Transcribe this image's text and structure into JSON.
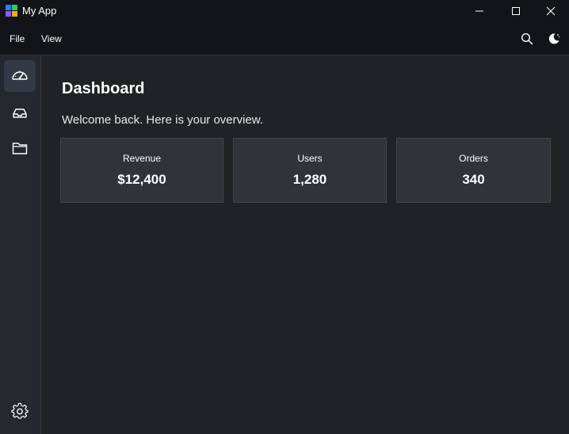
{
  "app": {
    "title": "My App",
    "logo_colors": [
      "#2e7df6",
      "#2ecc71",
      "#8f5cf6",
      "#f5a623"
    ]
  },
  "window_controls": {
    "minimize_icon": "minimize-icon",
    "maximize_icon": "maximize-icon",
    "close_icon": "close-icon"
  },
  "menu": {
    "items": [
      {
        "label": "File"
      },
      {
        "label": "View"
      }
    ],
    "right_icons": [
      "search-icon",
      "theme-moon-icon"
    ]
  },
  "sidebar": {
    "items": [
      {
        "icon": "dashboard-gauge-icon",
        "active": true
      },
      {
        "icon": "inbox-icon",
        "active": false
      },
      {
        "icon": "folder-icon",
        "active": false
      }
    ],
    "bottom_icon": "settings-gear-icon"
  },
  "main": {
    "title": "Dashboard",
    "subtitle": "Welcome back. Here is your overview.",
    "cards": [
      {
        "label": "Revenue",
        "value": "$12,400"
      },
      {
        "label": "Users",
        "value": "1,280"
      },
      {
        "label": "Orders",
        "value": "340"
      }
    ]
  },
  "colors": {
    "titlebar_bg": "#121418",
    "content_bg": "#202226",
    "sidebar_bg": "#25282e",
    "active_item_bg": "#333a47",
    "card_bg": "#30333a"
  }
}
